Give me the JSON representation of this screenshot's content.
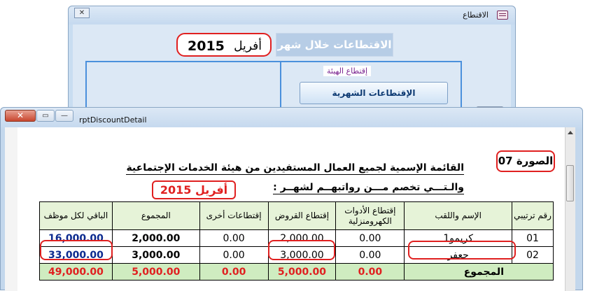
{
  "back_window": {
    "title": "الاقتطاع",
    "controls": {
      "close": "✕"
    },
    "month": {
      "name": "أفريل",
      "year": "2015"
    },
    "heading": "الاقتطاعات خلال شهر",
    "frame_label": "إقتطاع الهيئة",
    "monthly_button": "الإقتطاعات الشهرية"
  },
  "front_window": {
    "title": "rptDiscountDetail",
    "controls": {
      "close": "✕",
      "restore": "▭",
      "minimize": "—"
    }
  },
  "report": {
    "picture_label": "الصورة 07",
    "title_line1": "القائمة الإسمية  لجميع العمال المستفيدين من هيئة الخدمات الإجتماعية",
    "title_line2": "والـتـــي تخصم مـــن رواتبهــم لشهــر  :",
    "title_month": "أفريل 2015",
    "columns": [
      "رقم ترتيبي",
      "الإسم واللقب",
      "إقتطاع الأدوات الكهرومنزلية",
      "إقتطاع القروض",
      "إقتطاعات أخرى",
      "المجموع",
      "الباقي لكل موظف"
    ],
    "rows": [
      {
        "num": "01",
        "name": "كريمو1",
        "appliances": "0.00",
        "loans": "2,000.00",
        "other": "0.00",
        "total": "2,000.00",
        "remaining": "16,000.00"
      },
      {
        "num": "02",
        "name": "جعفر",
        "appliances": "0.00",
        "loans": "3,000.00",
        "other": "0.00",
        "total": "3,000.00",
        "remaining": "33,000.00"
      }
    ],
    "totals": {
      "label": "المجموع",
      "appliances": "0.00",
      "loans": "5,000.00",
      "other": "0.00",
      "total": "5,000.00",
      "remaining": "49,000.00"
    }
  },
  "colors": {
    "highlight": "#e02020",
    "accent_blue": "#0b2a8f",
    "header_bg": "#e6f3d8",
    "total_bg": "#cfecc0"
  },
  "icons": [
    "app-form-icon",
    "close-icon",
    "restore-icon",
    "minimize-icon",
    "scroll-up-icon"
  ]
}
